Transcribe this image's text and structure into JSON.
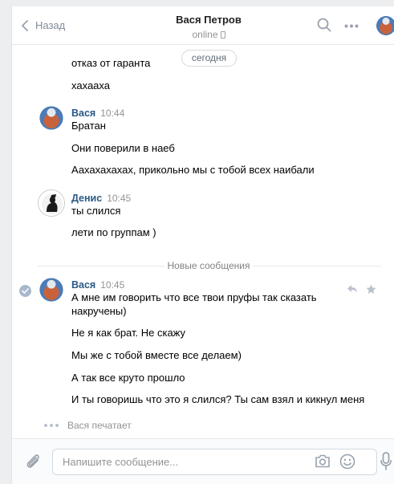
{
  "header": {
    "back_label": "Назад",
    "title": "Вася Петров",
    "status": "online"
  },
  "date_separator": "сегодня",
  "messages": [
    {
      "text": "отказ от гаранта"
    },
    {
      "text": "хахааха"
    },
    {
      "author": "Вася",
      "time": "10:44",
      "text": "Братан"
    },
    {
      "text": "Они поверили в наеб"
    },
    {
      "text": "Аахахахахах, прикольно мы с тобой всех наибали"
    },
    {
      "author": "Денис",
      "time": "10:45",
      "text": "ты слился"
    },
    {
      "text": "лети по группам )"
    },
    {
      "author": "Вася",
      "time": "10:45",
      "text": "А мне им говорить что все твои пруфы так сказать",
      "text2": "накручены)"
    },
    {
      "text": "Не я как брат. Не скажу"
    },
    {
      "text": "Мы же с тобой вместе все делаем)"
    },
    {
      "text": "А так все круто прошло"
    },
    {
      "text": "И ты говоришь что это я слился? Ты сам взял и кикнул меня"
    }
  ],
  "new_messages_label": "Новые сообщения",
  "typing": "Вася печатает",
  "composer": {
    "placeholder": "Напишите сообщение..."
  },
  "colors": {
    "link": "#2a5885",
    "muted": "#939393",
    "accent": "#5181b8"
  }
}
